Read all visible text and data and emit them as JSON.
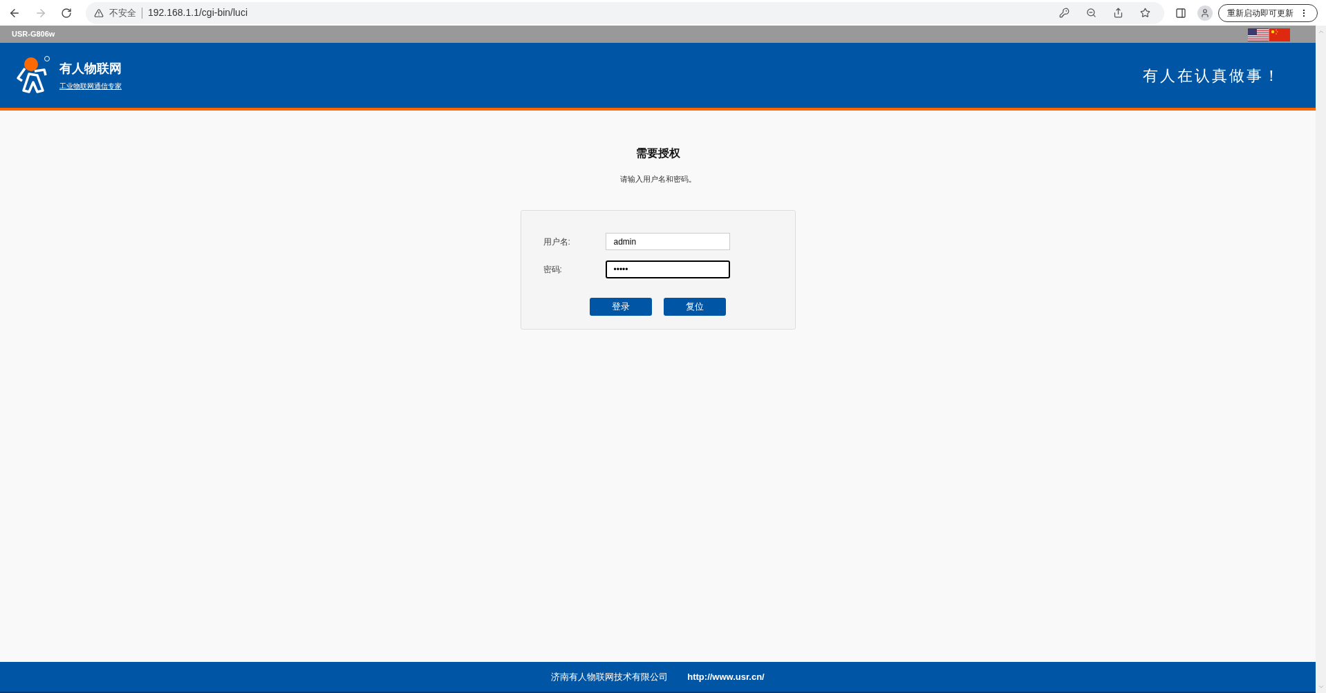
{
  "browser": {
    "security_label": "不安全",
    "url": "192.168.1.1/cgi-bin/luci",
    "forward_disabled": true,
    "update_button": "重新启动即可更新"
  },
  "topbar": {
    "model": "USR-G806w",
    "languages": [
      {
        "kind": "us"
      },
      {
        "kind": "cn"
      }
    ]
  },
  "header": {
    "brand": "有人物联网",
    "tagline": "工业物联网通信专家",
    "slogan": "有人在认真做事！"
  },
  "login": {
    "title": "需要授权",
    "hint": "请输入用户名和密码。",
    "fields": [
      {
        "label": "用户名:",
        "value": "admin",
        "focused": false
      },
      {
        "label": "密码:",
        "value": "•••••",
        "focused": true
      }
    ],
    "buttons": [
      "登录",
      "复位"
    ]
  },
  "footer": {
    "company": "济南有人物联网技术有限公司",
    "link": "http://www.usr.cn/"
  }
}
